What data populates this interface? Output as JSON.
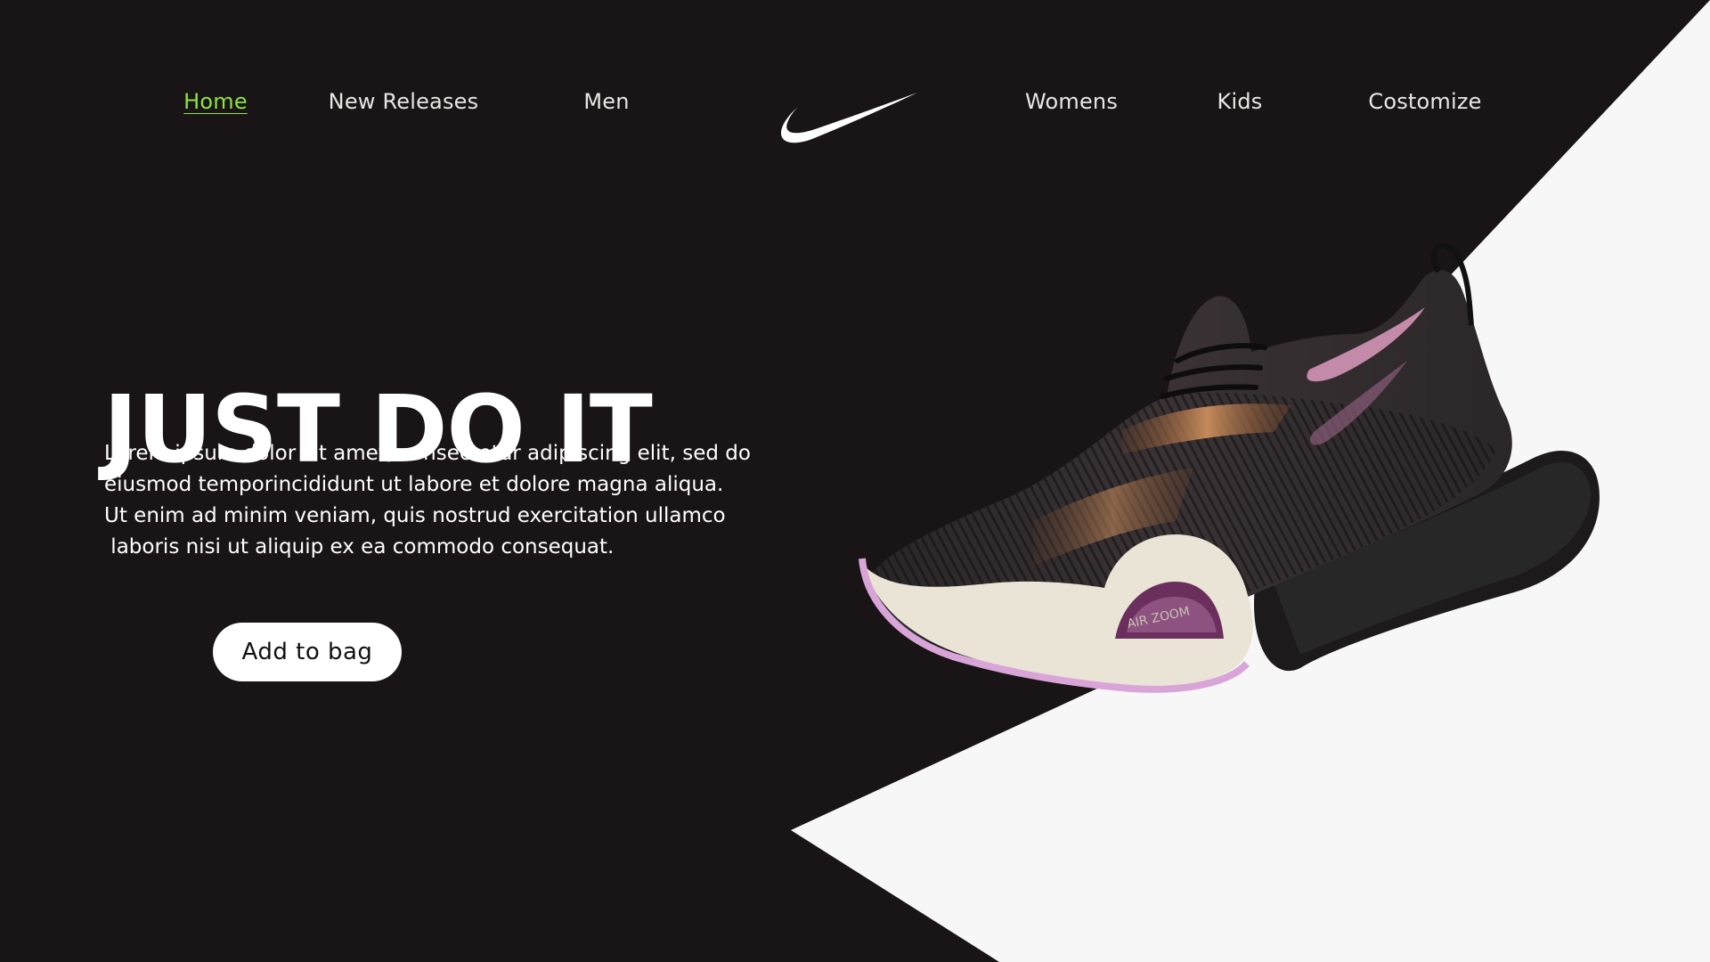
{
  "nav": {
    "items": [
      {
        "label": "Home",
        "active": true
      },
      {
        "label": "New Releases"
      },
      {
        "label": "Men"
      },
      {
        "label": "Womens"
      },
      {
        "label": "Kids"
      },
      {
        "label": "Costomize"
      }
    ]
  },
  "hero": {
    "title": "JUST DO IT",
    "copy_lines": [
      "Lorem ipsum dolor sit amet, consectetur adipiscing elit, sed do",
      "eiusmod temporincididunt ut labore et dolore magna aliqua.",
      "Ut enim ad minim veniam, quis nostrud exercitation ullamco",
      " laboris nisi ut aliquip ex ea commodo consequat."
    ],
    "cta_label": "Add to bag"
  },
  "product": {
    "midsole_text": "AIR ZOOM",
    "icon": "running-shoe"
  },
  "colors": {
    "background": "#191516",
    "accent": "#8fe23f",
    "panel": "#f7f7f7",
    "text": "#ffffff"
  },
  "brand": {
    "logo_icon": "swoosh-logo"
  }
}
